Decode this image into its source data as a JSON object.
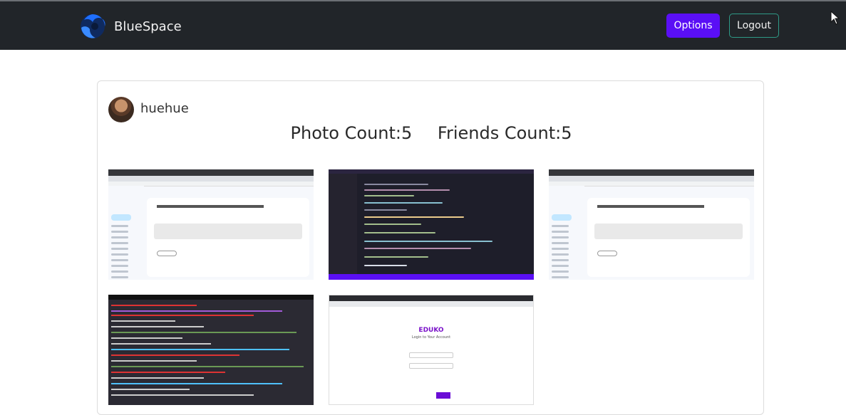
{
  "navbar": {
    "brand_name": "BlueSpace",
    "logo_icon": "bluespace-logo-icon",
    "options_label": "Options",
    "logout_label": "Logout",
    "colors": {
      "background": "#212529",
      "options": "#5a0ff5",
      "logout_border": "#2e9a87"
    }
  },
  "profile": {
    "username": "huehue",
    "photo_count": "Photo Count:5",
    "friends_count": "Friends Count:5"
  },
  "photos": [
    {
      "kind": "gmail-screenshot"
    },
    {
      "kind": "code-editor-screenshot"
    },
    {
      "kind": "gmail-screenshot"
    },
    {
      "kind": "terminal-screenshot"
    },
    {
      "kind": "login-page-screenshot",
      "title": "EDUKO",
      "subtitle": "Login to Your Account"
    }
  ]
}
